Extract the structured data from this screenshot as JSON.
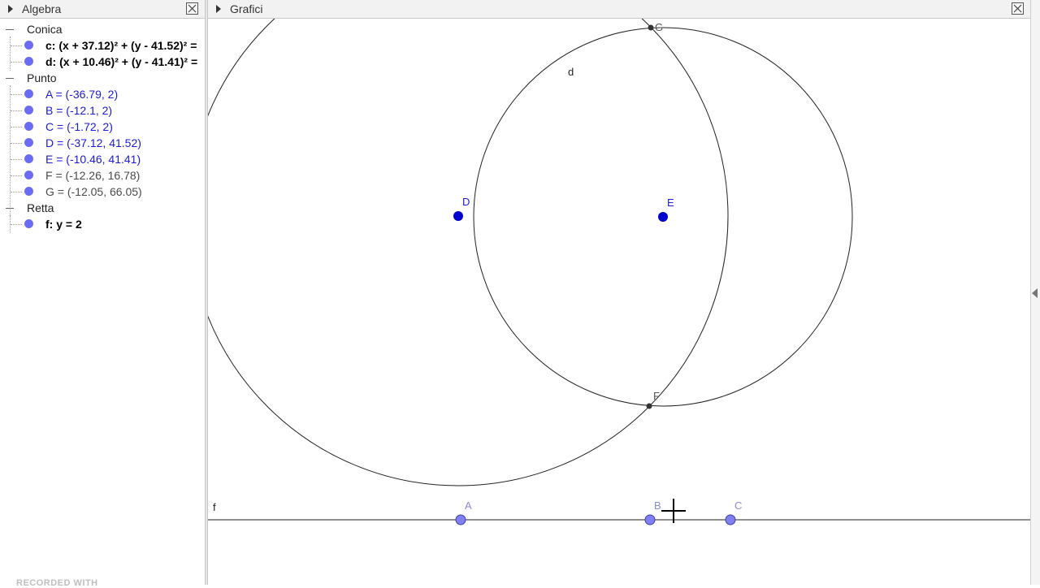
{
  "algebra_panel": {
    "title": "Algebra",
    "categories": [
      {
        "label": "Conica",
        "items": [
          {
            "text": "c: (x + 37.12)² + (y - 41.52)² =",
            "style": "black"
          },
          {
            "text": "d: (x + 10.46)² + (y - 41.41)² =",
            "style": "black"
          }
        ]
      },
      {
        "label": "Punto",
        "items": [
          {
            "text": "A = (-36.79, 2)",
            "style": "blue"
          },
          {
            "text": "B = (-12.1, 2)",
            "style": "blue"
          },
          {
            "text": "C = (-1.72, 2)",
            "style": "blue"
          },
          {
            "text": "D = (-37.12, 41.52)",
            "style": "blue"
          },
          {
            "text": "E = (-10.46, 41.41)",
            "style": "blue"
          },
          {
            "text": "F = (-12.26, 16.78)",
            "style": "grey"
          },
          {
            "text": "G = (-12.05, 66.05)",
            "style": "grey"
          }
        ]
      },
      {
        "label": "Retta",
        "items": [
          {
            "text": "f: y = 2",
            "style": "black"
          }
        ]
      }
    ]
  },
  "graphics_panel": {
    "title": "Grafici",
    "labels": {
      "d": "D",
      "e": "E",
      "f_pt": "F",
      "g_pt": "G",
      "a": "A",
      "b": "B",
      "c": "C",
      "circle_d": "d",
      "line_f": "f"
    }
  },
  "watermark": "RECORDED WITH",
  "colors": {
    "point_free": "#6b6bf5",
    "point_dep": "#333333",
    "point_center": "#0000cc",
    "label_blue": "#1b1bd6"
  }
}
